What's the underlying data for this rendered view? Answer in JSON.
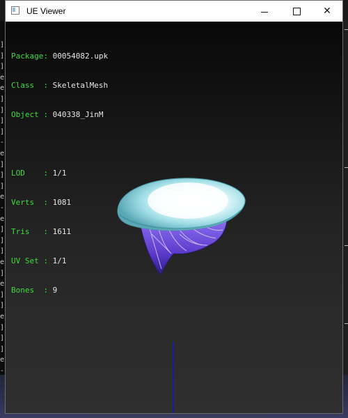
{
  "window": {
    "title": "UE Viewer"
  },
  "titlebar": {
    "minimize": "",
    "maximize": "",
    "close": "✕"
  },
  "info": {
    "package": {
      "label": "Package:",
      "value": "00054082.upk"
    },
    "class": {
      "label": "Class  :",
      "value": "SkeletalMesh"
    },
    "object": {
      "label": "Object :",
      "value": "040338_JinM"
    },
    "lod": {
      "label": "LOD    :",
      "value": "1/1"
    },
    "verts": {
      "label": "Verts  :",
      "value": "1081"
    },
    "tris": {
      "label": "Tris   :",
      "value": "1611"
    },
    "uvset": {
      "label": "UV Set :",
      "value": "1/1"
    },
    "bones": {
      "label": "Bones  :",
      "value": "9"
    }
  },
  "background_console": {
    "glyphs": [
      "]",
      "]",
      "]",
      "e",
      "e",
      "]",
      "]",
      "]",
      "]",
      "-",
      "e",
      "]",
      "]",
      "]",
      "e",
      "-",
      "e",
      "]",
      "]",
      "]",
      "e",
      "]",
      "e",
      "]",
      "]",
      "e",
      "]",
      "]",
      "]",
      "e",
      "-",
      "]",
      "e",
      "]"
    ]
  },
  "colors": {
    "label_green": "#3fdc3f",
    "value_white": "#e6e6e6",
    "axis_blue": "#1a1aa8",
    "mesh_cyan": "#bfeff5",
    "mesh_purple": "#6f4fd8"
  }
}
